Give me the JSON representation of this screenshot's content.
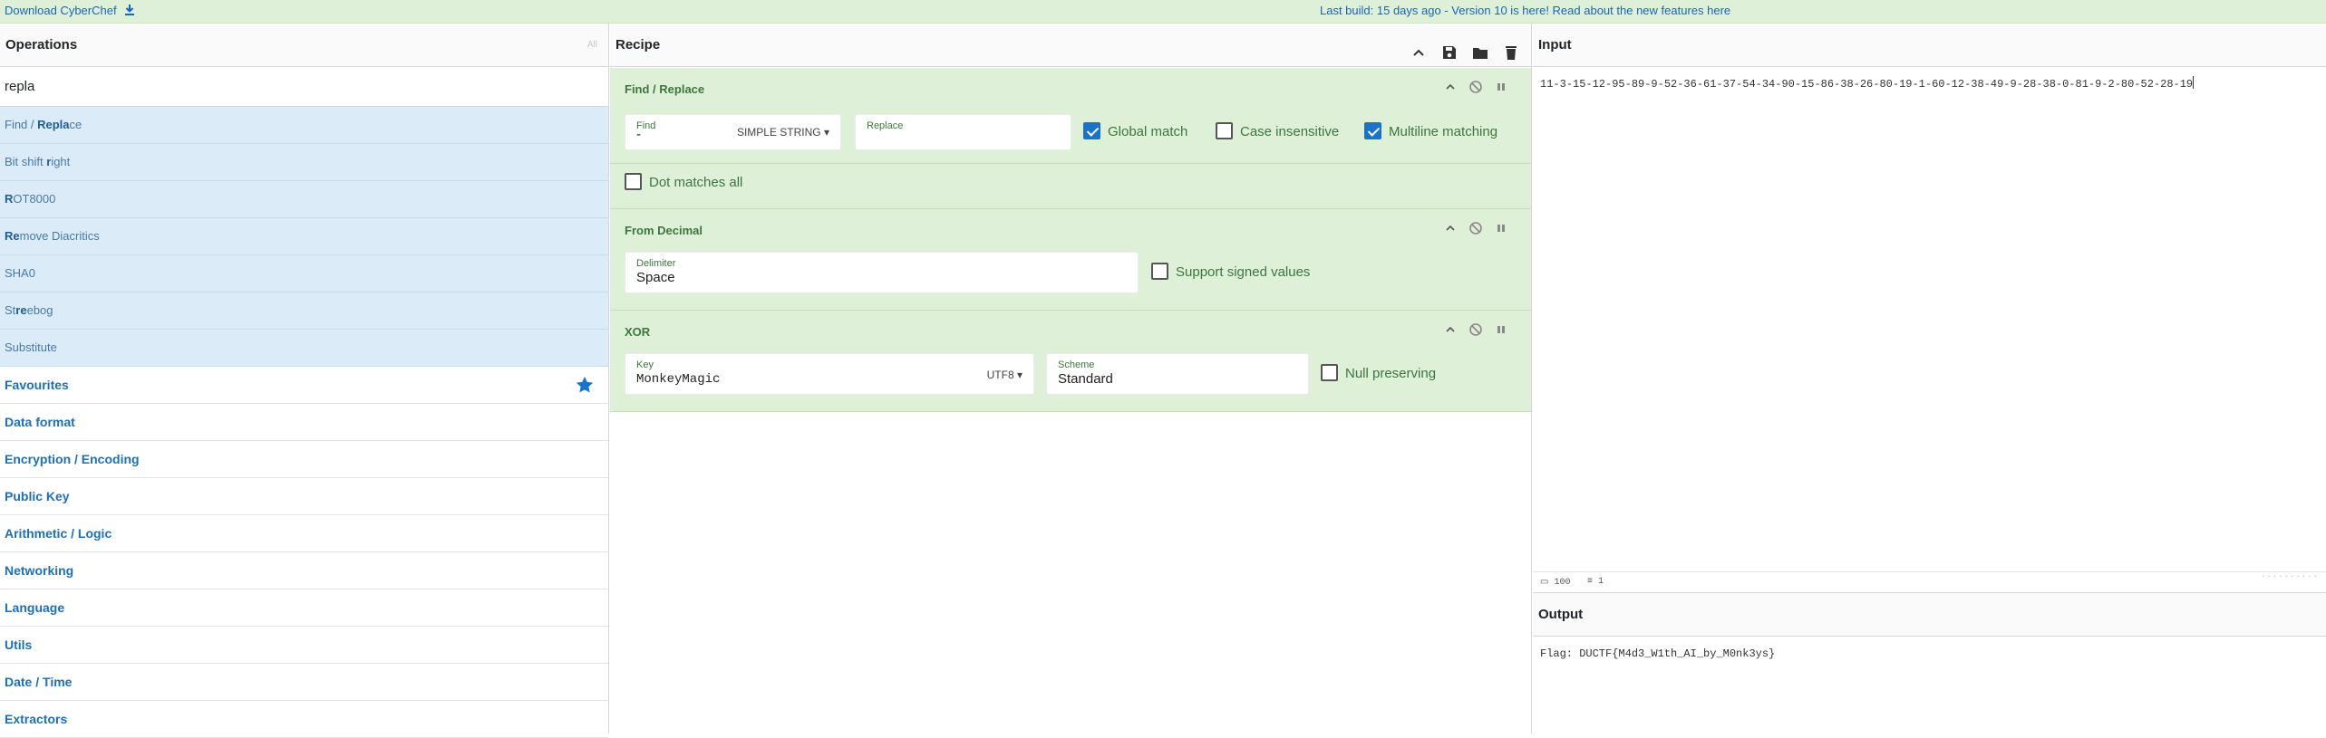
{
  "banner": {
    "download_label": "Download CyberChef",
    "news": "Last build: 15 days ago - Version 10 is here! Read about the new features here",
    "accent": "#1565c0"
  },
  "operations": {
    "title": "Operations",
    "count_label": "All",
    "search_value": "repla",
    "results": [
      {
        "pre": "Find / ",
        "match": "Repla",
        "post": "ce"
      },
      {
        "pre": "Bit shift ",
        "match": "r",
        "post": "ight"
      },
      {
        "pre": "",
        "match": "R",
        "post": "OT8000"
      },
      {
        "pre": "",
        "match": "Re",
        "post": "move Diacritics"
      },
      {
        "pre": "SHA0",
        "match": "",
        "post": ""
      },
      {
        "pre": "St",
        "match": "re",
        "post": "ebog"
      },
      {
        "pre": "Substitute",
        "match": "",
        "post": ""
      }
    ],
    "categories": [
      "Favourites",
      "Data format",
      "Encryption / Encoding",
      "Public Key",
      "Arithmetic / Logic",
      "Networking",
      "Language",
      "Utils",
      "Date / Time",
      "Extractors"
    ]
  },
  "recipe": {
    "title": "Recipe",
    "ops": {
      "find_replace": {
        "title": "Find / Replace",
        "find_label": "Find",
        "find_value": "-",
        "find_type": "SIMPLE STRING",
        "replace_label": "Replace",
        "replace_value": "",
        "global_match": "Global match",
        "case_insensitive": "Case insensitive",
        "multiline": "Multiline matching",
        "dot_all": "Dot matches all"
      },
      "from_decimal": {
        "title": "From Decimal",
        "delimiter_label": "Delimiter",
        "delimiter_value": "Space",
        "signed": "Support signed values"
      },
      "xor": {
        "title": "XOR",
        "key_label": "Key",
        "key_value": "MonkeyMagic",
        "key_encoding": "UTF8",
        "scheme_label": "Scheme",
        "scheme_value": "Standard",
        "null_preserving": "Null preserving"
      }
    }
  },
  "input": {
    "title": "Input",
    "value": "11-3-15-12-95-89-9-52-36-61-37-54-34-90-15-86-38-26-80-19-1-60-12-38-49-9-28-38-0-81-9-2-80-52-28-19",
    "length": "100",
    "lines": "1"
  },
  "output": {
    "title": "Output",
    "value": "Flag: DUCTF{M4d3_W1th_AI_by_M0nk3ys}"
  }
}
